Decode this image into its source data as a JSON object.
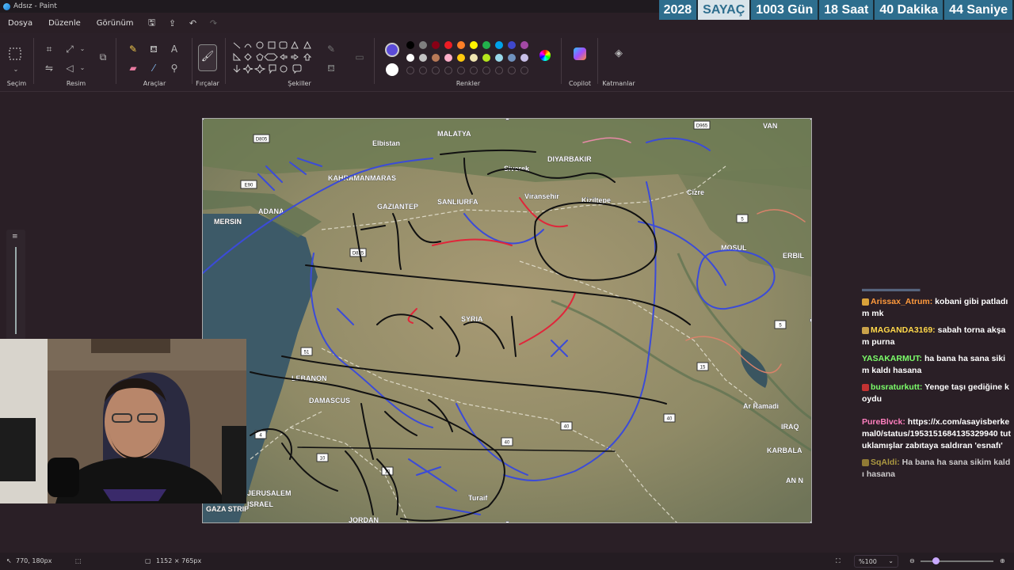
{
  "window": {
    "title": "Adsız - Paint"
  },
  "counter": [
    {
      "text": "2028"
    },
    {
      "text": "SAYAÇ"
    },
    {
      "text": "1003 Gün"
    },
    {
      "text": "18 Saat"
    },
    {
      "text": "40 Dakika"
    },
    {
      "text": "44 Saniye"
    }
  ],
  "menu": {
    "file": "Dosya",
    "edit": "Düzenle",
    "view": "Görünüm"
  },
  "ribbon": {
    "selection": "Seçim",
    "image": "Resim",
    "tools": "Araçlar",
    "brushes": "Fırçalar",
    "shapes": "Şekiller",
    "colors": "Renkler",
    "copilot": "Copilot",
    "layers": "Katmanlar"
  },
  "palette": {
    "primary": "#5b4bd8",
    "secondary": "#ffffff",
    "row1": [
      "#000000",
      "#7f7f7f",
      "#880015",
      "#ed1c24",
      "#ff7f27",
      "#fff200",
      "#22b14c",
      "#00a2e8",
      "#3f48cc",
      "#a349a4"
    ],
    "row2": [
      "#ffffff",
      "#c3c3c3",
      "#b97a57",
      "#ffaec9",
      "#ffc90e",
      "#efe4b0",
      "#b5e61d",
      "#99d9ea",
      "#7092be",
      "#c8bfe7"
    ]
  },
  "map": {
    "labels": [
      {
        "t": "MALATYA"
      },
      {
        "t": "Elbistan"
      },
      {
        "t": "VAN"
      },
      {
        "t": "DIYARBAKIR"
      },
      {
        "t": "Siverek"
      },
      {
        "t": "KAHRAMANMARAS"
      },
      {
        "t": "SANLIURFA"
      },
      {
        "t": "Viransehir"
      },
      {
        "t": "Kiziltepe"
      },
      {
        "t": "Cizre"
      },
      {
        "t": "MERSIN"
      },
      {
        "t": "ADANA"
      },
      {
        "t": "GAZIANTEP"
      },
      {
        "t": "MOSUL"
      },
      {
        "t": "ERBIL"
      },
      {
        "t": "SYRIA"
      },
      {
        "t": "LEBANON"
      },
      {
        "t": "DAMASCUS"
      },
      {
        "t": "Ar Ramadi"
      },
      {
        "t": "IRAQ"
      },
      {
        "t": "KARBALA"
      },
      {
        "t": "AN N"
      },
      {
        "t": "Turaif"
      },
      {
        "t": "JERUSALEM"
      },
      {
        "t": "ISRAEL"
      },
      {
        "t": "JORDAN"
      },
      {
        "t": "GAZA STRIP"
      }
    ],
    "shields": [
      {
        "t": "D805"
      },
      {
        "t": "D965"
      },
      {
        "t": "E90"
      },
      {
        "t": "D825"
      },
      {
        "t": "5"
      },
      {
        "t": "5"
      },
      {
        "t": "51"
      },
      {
        "t": "4"
      },
      {
        "t": "10"
      },
      {
        "t": "10"
      },
      {
        "t": "40"
      },
      {
        "t": "40"
      },
      {
        "t": "40"
      },
      {
        "t": "15"
      }
    ]
  },
  "chat": [
    {
      "user": "Arissax_Atrum",
      "color": "#ff9a3c",
      "text": "kobani gibi patladım mk"
    },
    {
      "user": "MAGANDA3169",
      "color": "#ffd84a",
      "text": "sabah torna akşam purna"
    },
    {
      "user": "YASAKARMUT",
      "color": "#7cff6a",
      "text": "ha bana ha sana sikim kaldı hasana"
    },
    {
      "user": "busraturkutt",
      "color": "#7cff6a",
      "text": "Yenge taşı gediğine koydu"
    },
    {
      "user": "PureBlvck",
      "color": "#ff7fbf",
      "text": "https://x.com/asayisberkemal0/status/1953151684135329940 tutuklamışlar zabıtaya saldıran 'esnafı'"
    },
    {
      "user": "SqAldi",
      "color": "#d8c24a",
      "text": "Ha bana ha sana sikim kaldı hasana"
    }
  ],
  "status": {
    "cursor": "770, 180px",
    "size": "1152 × 765px",
    "zoom": "%100"
  }
}
